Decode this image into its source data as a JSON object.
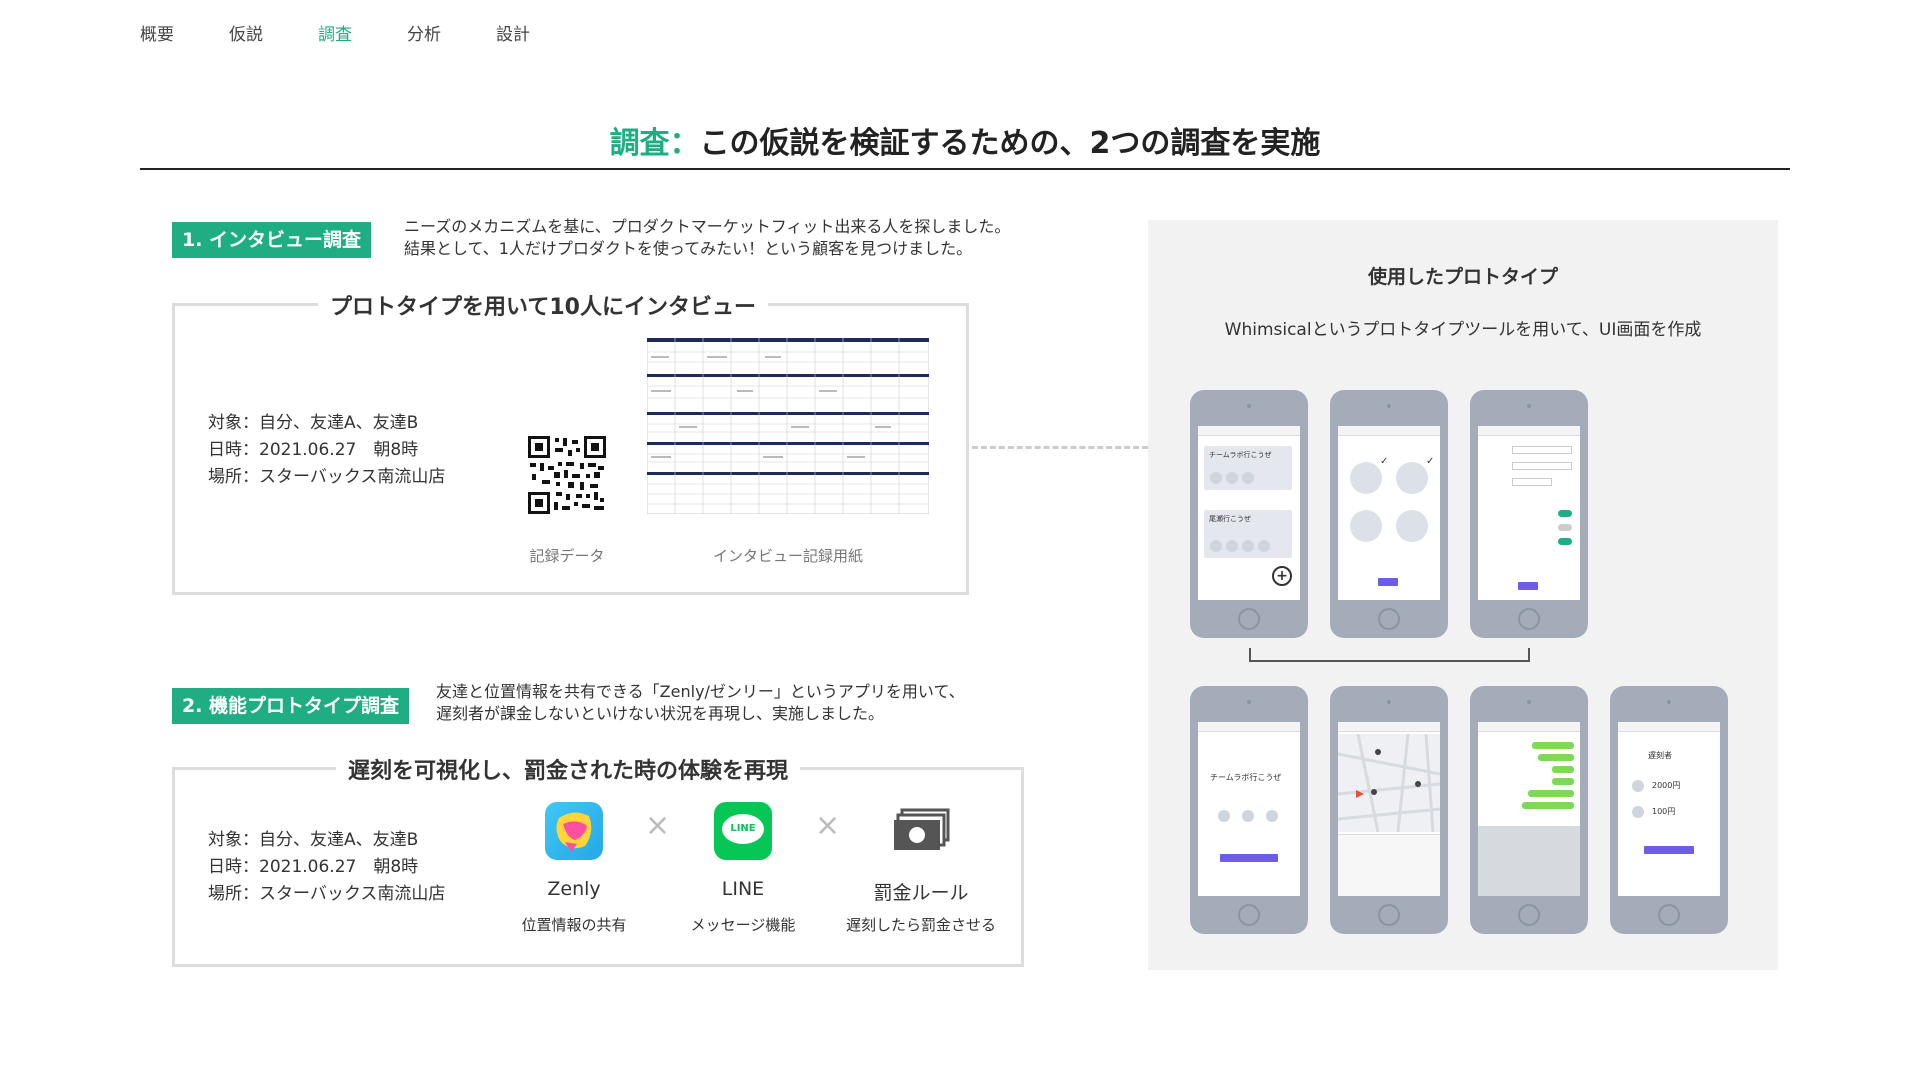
{
  "nav": {
    "items": [
      "概要",
      "仮説",
      "調査",
      "分析",
      "設計"
    ],
    "active_index": 2
  },
  "heading": {
    "accent": "調査：",
    "text": "この仮説を検証するための、2つの調査を実施"
  },
  "section1": {
    "tag": "1. インタビュー調査",
    "desc_line1": "ニーズのメカニズムを基に、プロダクトマーケットフィット出来る人を探しました。",
    "desc_line2": "結果として、1人だけプロダクトを使ってみたい！という顧客を見つけました。",
    "box_title": "プロトタイプを用いて10人にインタビュー",
    "info": {
      "target": "対象：自分、友達A、友達B",
      "date": "日時：2021.06.27　朝8時",
      "place": "場所：スターバックス南流山店"
    },
    "caption_qr": "記録データ",
    "caption_sheet": "インタビュー記録用紙"
  },
  "section2": {
    "tag": "2. 機能プロトタイプ調査",
    "desc_line1": "友達と位置情報を共有できる「Zenly/ゼンリー」というアプリを用いて、",
    "desc_line2": "遅刻者が課金しないといけない状況を再現し、実施しました。",
    "box_title": "遅刻を可視化し、罰金された時の体験を再現",
    "info": {
      "target": "対象：自分、友達A、友達B",
      "date": "日時：2021.06.27　朝8時",
      "place": "場所：スターバックス南流山店"
    },
    "services": [
      {
        "name": "Zenly",
        "desc": "位置情報の共有",
        "icon": "zenly-icon"
      },
      {
        "name": "LINE",
        "desc": "メッセージ機能",
        "icon": "line-icon"
      },
      {
        "name": "罰金ルール",
        "desc": "遅刻したら罰金させる",
        "icon": "money-icon"
      }
    ],
    "line_icon_text": "LINE"
  },
  "panel": {
    "title": "使用したプロトタイプ",
    "subtitle": "Whimsicalというプロトタイプツールを用いて、UI画面を作成"
  },
  "phones": {
    "p1_card1": "チームラボ行こうぜ",
    "p1_card2": "尾瀬行こうぜ",
    "p5_title": "チームラボ行こうぜ",
    "p8_title": "遅刻者",
    "p8_amount1": "2000円",
    "p8_amount2": "100円"
  },
  "colors": {
    "accent": "#1fae83",
    "phone": "#a3acb8",
    "panel": "#f2f2f2"
  }
}
